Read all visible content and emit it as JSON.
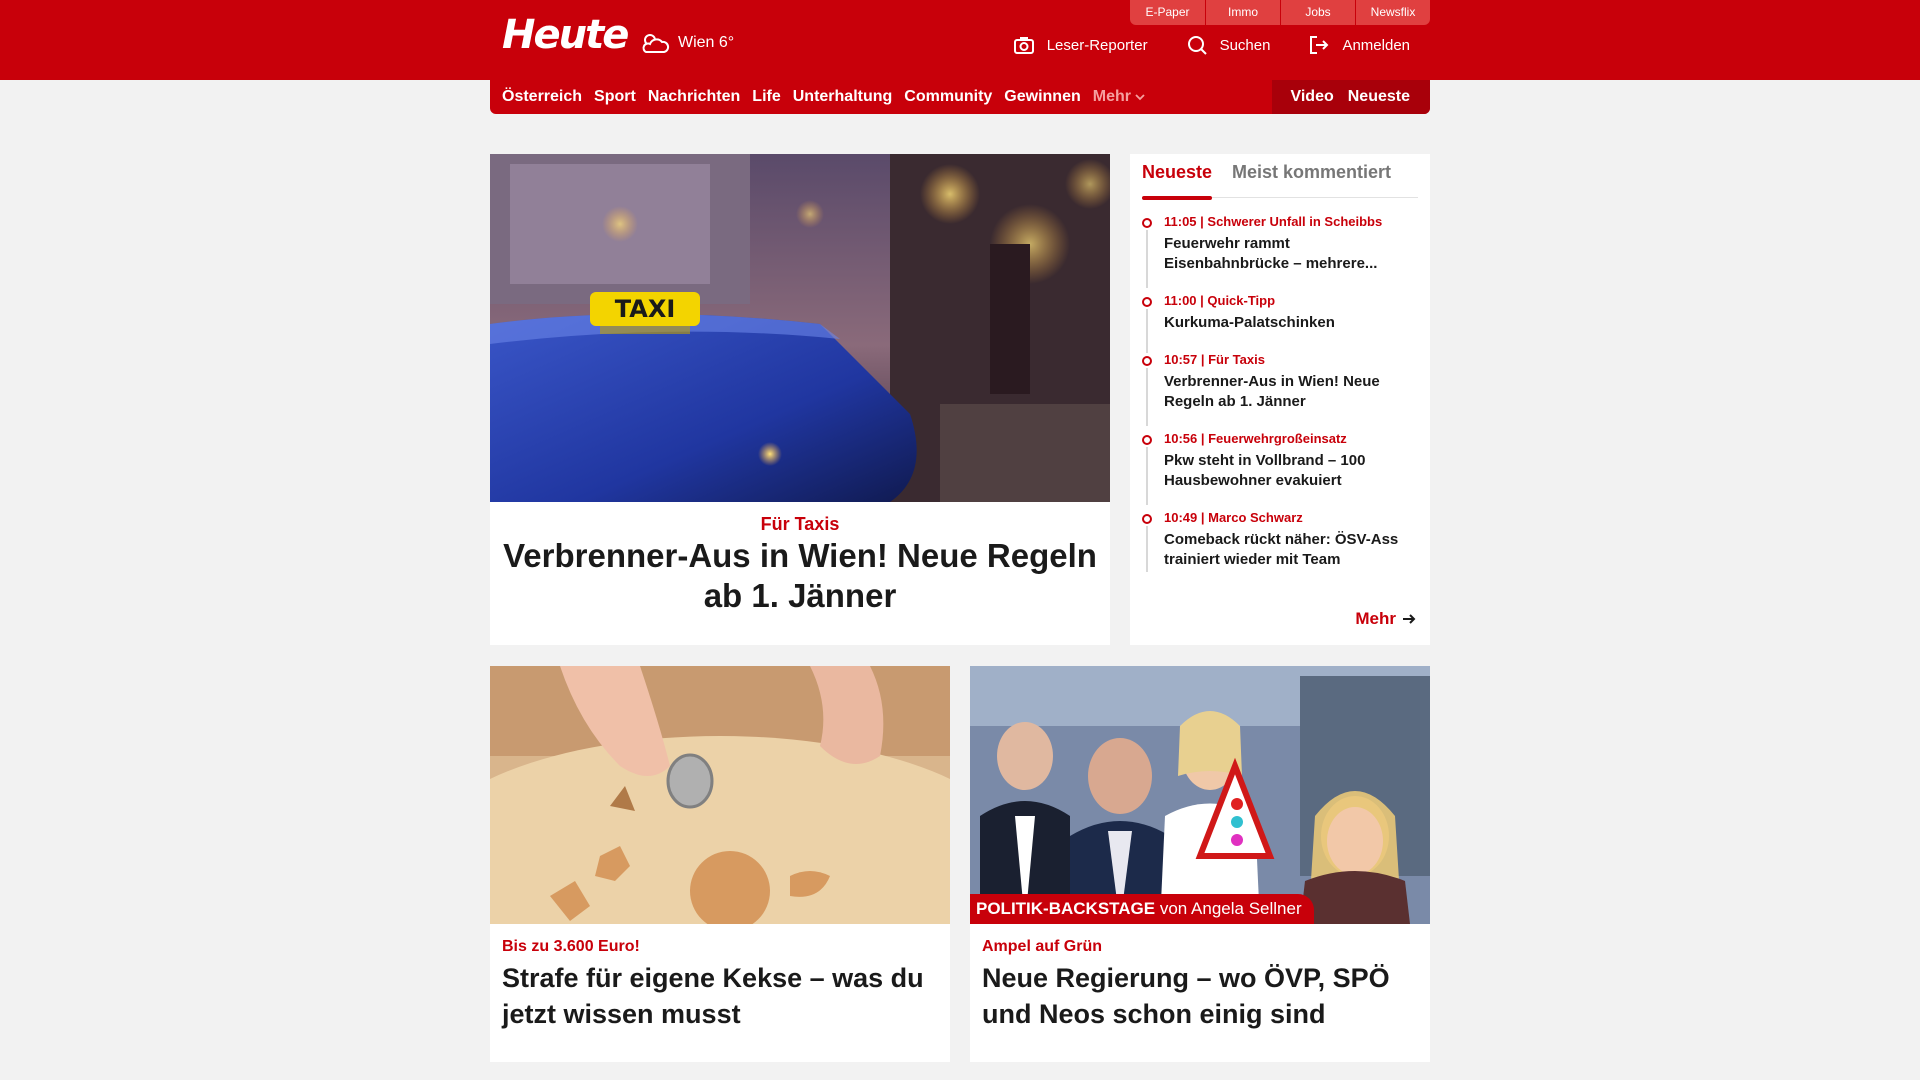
{
  "header": {
    "logo": "Heute",
    "weather": "Wien 6°",
    "top_links": [
      "E-Paper",
      "Immo",
      "Jobs",
      "Newsflix"
    ],
    "actions": [
      {
        "label": "Leser-Reporter",
        "icon": "camera-icon"
      },
      {
        "label": "Suchen",
        "icon": "search-icon"
      },
      {
        "label": "Anmelden",
        "icon": "login-icon"
      }
    ]
  },
  "nav": {
    "items": [
      "Österreich",
      "Sport",
      "Nachrichten",
      "Life",
      "Unterhaltung",
      "Community",
      "Gewinnen"
    ],
    "more": "Mehr",
    "right": [
      "Video",
      "Neueste"
    ]
  },
  "hero": {
    "category": "Für Taxis",
    "title": "Verbrenner-Aus in Wien! Neue Regeln ab 1. Jänner",
    "image_sign": "TAXI"
  },
  "sidebar": {
    "tabs": [
      "Neueste",
      "Meist kommentiert"
    ],
    "items": [
      {
        "meta": "11:05 | Schwerer Unfall in Scheibbs",
        "title": "Feuerwehr rammt Eisenbahnbrücke – mehrere..."
      },
      {
        "meta": "11:00 | Quick-Tipp",
        "title": "Kurkuma-Palatschinken"
      },
      {
        "meta": "10:57 | Für Taxis",
        "title": "Verbrenner-Aus in Wien! Neue Regeln ab 1. Jänner"
      },
      {
        "meta": "10:56 | Feuerwehrgroßeinsatz",
        "title": "Pkw steht in Vollbrand – 100 Hausbewohner evakuiert"
      },
      {
        "meta": "10:49 | Marco Schwarz",
        "title": "Comeback rückt näher: ÖSV-Ass trainiert wieder mit Team"
      }
    ],
    "more": "Mehr"
  },
  "cards": [
    {
      "category": "Bis zu 3.600 Euro!",
      "title": "Strafe für eigene Kekse – was du jetzt wissen musst"
    },
    {
      "category": "Ampel auf Grün",
      "title": "Neue Regierung – wo ÖVP, SPÖ und Neos schon einig sind",
      "banner_bold": "POLITIK-BACKSTAGE",
      "banner_rest": " von Angela Sellner"
    }
  ],
  "colors": {
    "brand": "#c8000a",
    "background": "#f2f2f2"
  }
}
